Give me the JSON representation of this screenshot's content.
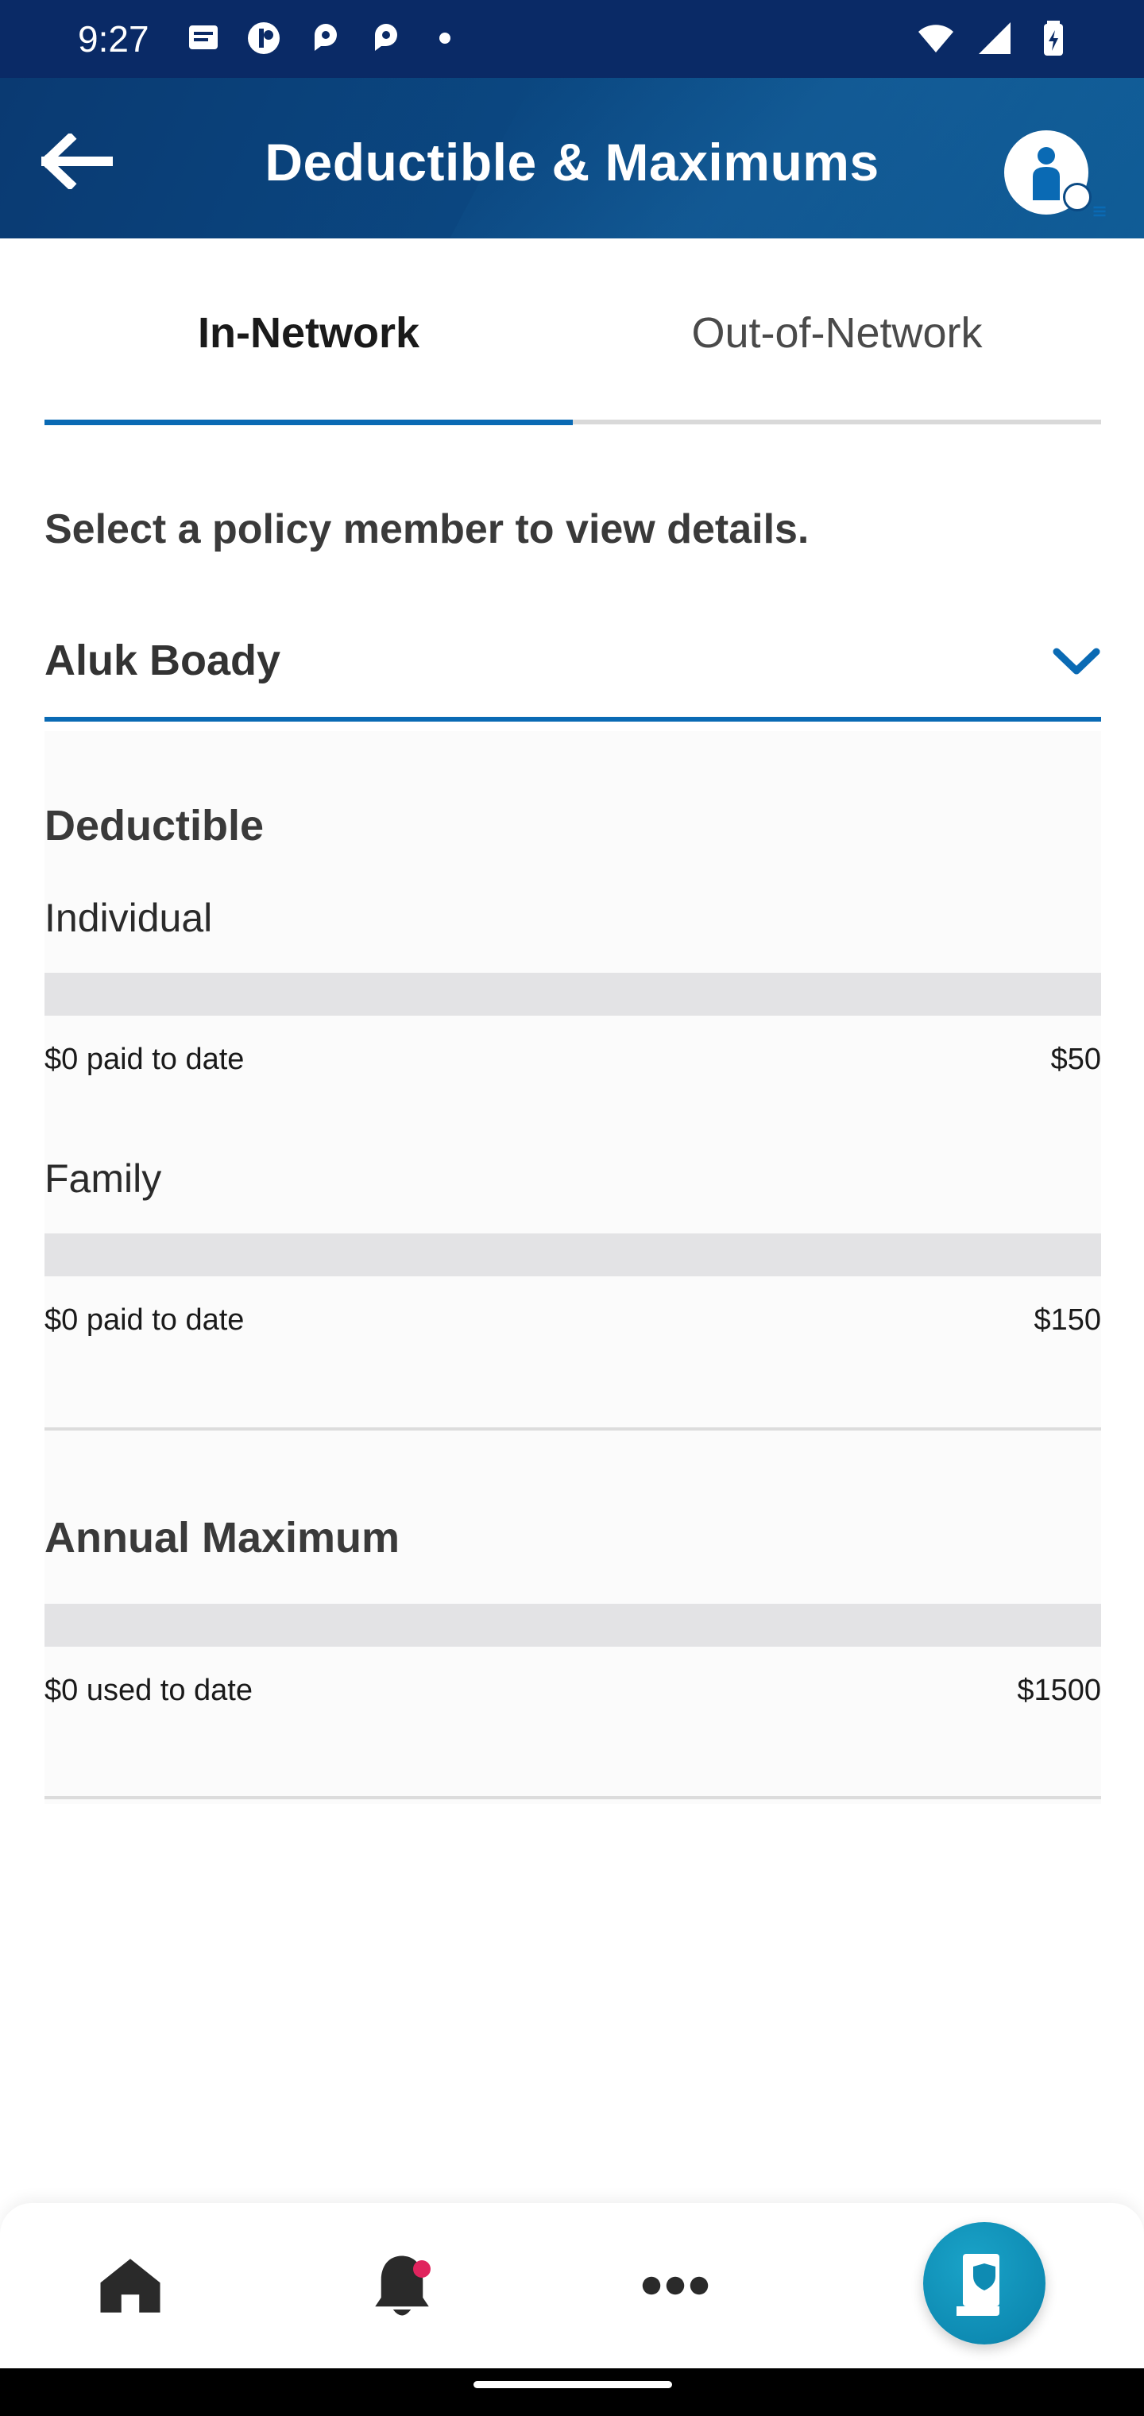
{
  "status_bar": {
    "time": "9:27",
    "left_icons": [
      "message-icon",
      "app-icon",
      "app-icon",
      "app-icon",
      "dot-icon"
    ],
    "right_icons": [
      "wifi-icon",
      "signal-icon",
      "battery-icon"
    ]
  },
  "header": {
    "title": "Deductible & Maximums",
    "back_icon": "arrow-left-icon",
    "profile_icon": "person-icon"
  },
  "tabs": [
    {
      "label": "In-Network",
      "active": true
    },
    {
      "label": "Out-of-Network",
      "active": false
    }
  ],
  "member_selector": {
    "prompt": "Select a policy member to view details.",
    "selected": "Aluk Boady"
  },
  "deductible": {
    "title": "Deductible",
    "individual": {
      "label": "Individual",
      "paid": "$0 paid to date",
      "limit": "$50",
      "progress": 0
    },
    "family": {
      "label": "Family",
      "paid": "$0 paid to date",
      "limit": "$150",
      "progress": 0
    }
  },
  "annual_maximum": {
    "title": "Annual Maximum",
    "used": "$0 used to date",
    "limit": "$1500",
    "progress": 0
  },
  "bottom_nav": {
    "items": [
      "home-icon",
      "bell-icon",
      "more-icon"
    ],
    "fab_icon": "id-card-icon"
  },
  "colors": {
    "header": "#0b4a84",
    "accent": "#0a6ab4",
    "fab": "#0e8bb3",
    "notification": "#e0245e"
  }
}
